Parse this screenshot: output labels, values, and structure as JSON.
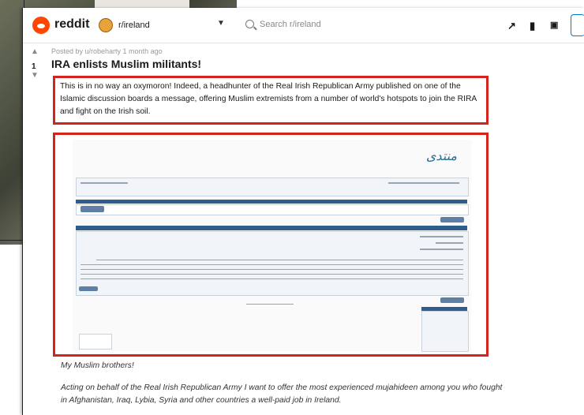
{
  "header": {
    "logo_text": "reddit",
    "subreddit": "r/ireland",
    "dropdown_caret": "▼",
    "search_placeholder": "Search r/ireland",
    "icons": [
      "trending-icon",
      "stats-icon",
      "chat-icon"
    ]
  },
  "post": {
    "posted_by": "Posted by u/robeharty 1 month ago",
    "vote_count": "1",
    "title": "IRA enlists Muslim militants!",
    "intro": "This is in no way an oxymoron! Indeed, a headhunter of the Real Irish Republican Army published on one of the Islamic discussion boards a message, offering Muslim extremists from a number of world's hotspots to join the RIRA and fight on the Irish soil.",
    "greeting": "My Muslim brothers!",
    "quote": "Acting on behalf of the Real Irish Republican Army I want to offer the most experienced mujahideen among you who fought in Afghanistan, Iraq, Lybia, Syria and other countries a well-paid job in Ireland."
  },
  "embedded_screenshot": {
    "banner_text": "منتدى",
    "colors": {
      "header_bar": "#2e5d8e",
      "panel": "#f1f4f8"
    }
  },
  "colors": {
    "highlight": "#d4241e",
    "reddit_orange": "#ff4500",
    "link_blue": "#0079d3"
  }
}
